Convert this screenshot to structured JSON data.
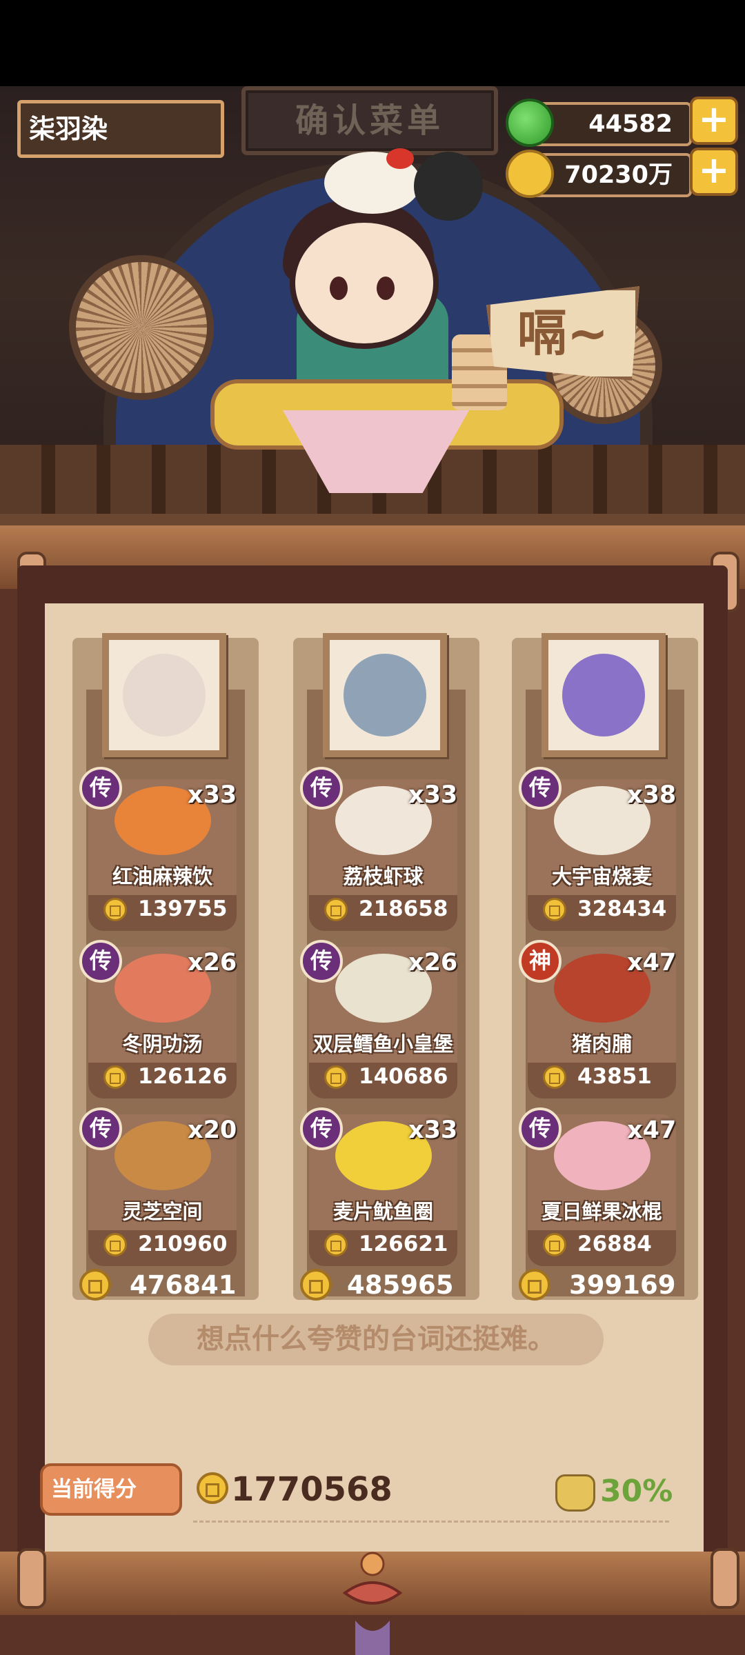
{
  "header": {
    "player_name": "柒羽染",
    "sign_title": "确认菜单",
    "shout": "嗝~",
    "jade_amount": "44582",
    "coin_amount": "70230万",
    "plus_label": "+"
  },
  "columns": [
    {
      "total": "476841",
      "dishes": [
        {
          "rarity": "传",
          "count": "x33",
          "name": "红油麻辣饮",
          "price": "139755"
        },
        {
          "rarity": "传",
          "count": "x26",
          "name": "冬阴功汤",
          "price": "126126"
        },
        {
          "rarity": "传",
          "count": "x20",
          "name": "灵芝空间",
          "price": "210960"
        }
      ]
    },
    {
      "total": "485965",
      "dishes": [
        {
          "rarity": "传",
          "count": "x33",
          "name": "荔枝虾球",
          "price": "218658"
        },
        {
          "rarity": "传",
          "count": "x26",
          "name": "双层鳕鱼小皇堡",
          "price": "140686"
        },
        {
          "rarity": "传",
          "count": "x33",
          "name": "麦片鱿鱼圈",
          "price": "126621"
        }
      ]
    },
    {
      "total": "399169",
      "dishes": [
        {
          "rarity": "传",
          "count": "x38",
          "name": "大宇宙烧麦",
          "price": "328434"
        },
        {
          "rarity": "神",
          "count": "x47",
          "name": "猪肉脯",
          "price": "43851"
        },
        {
          "rarity": "传",
          "count": "x47",
          "name": "夏日鲜果冰棍",
          "price": "26884"
        }
      ]
    }
  ],
  "quote": "想点什么夸赞的台词还挺难。",
  "footer": {
    "score_label": "当前得分",
    "score_value": "1770568",
    "bonus_percent": "30%"
  },
  "colors": {
    "legend_badge": "#6b2f7a",
    "god_badge": "#c03a24",
    "coin_gold": "#f2c13a",
    "bonus_green": "#6ca33a"
  }
}
